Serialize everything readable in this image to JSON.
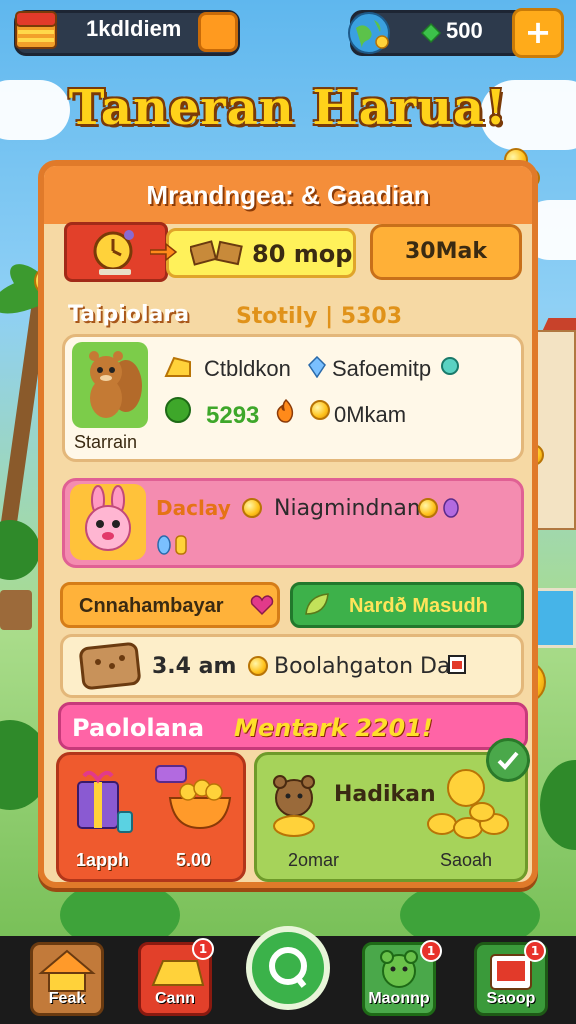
{
  "top_bar": {
    "left_text": "1kdldiem",
    "right_value": "500",
    "plus_label": "+"
  },
  "game_title": "Taneran Harua!",
  "panel": {
    "title": "Mrandngea: & Gaadian",
    "reward_value": "80 mop",
    "orange_button": "30Mak",
    "section_left": "Taipiolara",
    "section_right": "Stotily | 5303",
    "card1": {
      "name": "Starrain",
      "row1_a": "Ctbldkon",
      "row1_b": "Safoemitp",
      "row2_num": "5293",
      "row2_text": "0Mkam"
    },
    "card2": {
      "title": "Daclay",
      "text": "Niagmindnam"
    },
    "btn_left": "Cnnahambayar",
    "btn_right": "Nardð Masudh",
    "beige_row": {
      "value": "3.4 am",
      "text": "Boolahgaton Dal"
    },
    "banner": {
      "left": "Paololana",
      "right": "Mentark 2201!"
    },
    "card_red": {
      "label_left": "1apph",
      "label_right": "5.00"
    },
    "card_green": {
      "title": "Hadikan",
      "label_left": "2omar",
      "label_right": "Saoah"
    }
  },
  "bottom_nav": {
    "items": [
      {
        "label": "Feak",
        "icon": "house-icon"
      },
      {
        "label": "Cann",
        "icon": "gold-bar-icon",
        "badge": "1"
      },
      {
        "label": "",
        "icon": "search-icon"
      },
      {
        "label": "Maonnp",
        "icon": "bear-icon",
        "badge": "1"
      },
      {
        "label": "Saoop",
        "icon": "shop-icon",
        "badge": "1"
      }
    ]
  },
  "colors": {
    "panel_border": "#e07a2a",
    "title_yellow": "#ffd21a",
    "banner_pink": "#ff64a6",
    "accent_green": "#3db14a"
  }
}
